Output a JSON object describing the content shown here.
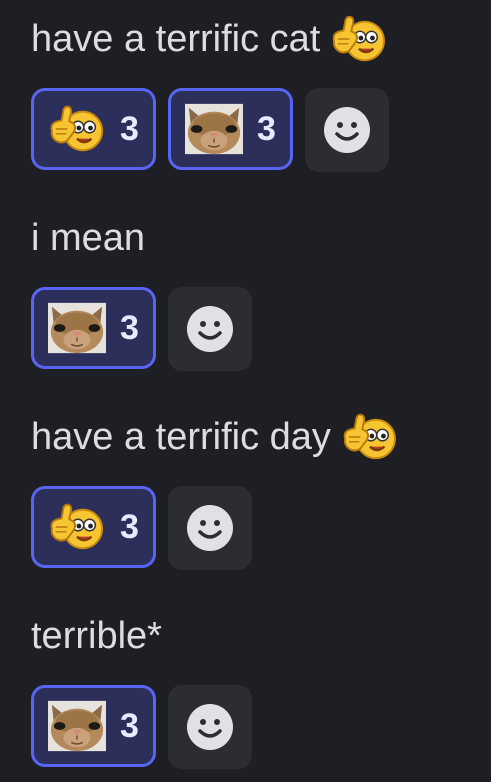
{
  "messages": [
    {
      "text": "have a terrific cat",
      "inline_emoji": "thumbs-up-smiley-emoji",
      "reactions": [
        {
          "emoji": "thumbs-up-smiley-emoji",
          "count": "3"
        },
        {
          "emoji": "cat-face-emoji",
          "count": "3"
        }
      ]
    },
    {
      "text": "i mean",
      "reactions": [
        {
          "emoji": "cat-face-emoji",
          "count": "3"
        }
      ]
    },
    {
      "text": "have a terrific day",
      "inline_emoji": "thumbs-up-smiley-emoji",
      "reactions": [
        {
          "emoji": "thumbs-up-smiley-emoji",
          "count": "3"
        }
      ]
    },
    {
      "text": "terrible*",
      "reactions": [
        {
          "emoji": "cat-face-emoji",
          "count": "3"
        }
      ]
    }
  ],
  "add_reaction_icon": "smile-icon",
  "colors": {
    "background": "#1e1f24",
    "text": "#dbdee1",
    "reaction_border": "#5865f2",
    "reaction_bg": "#2b2f5a",
    "add_reaction_bg": "#2b2d31"
  }
}
